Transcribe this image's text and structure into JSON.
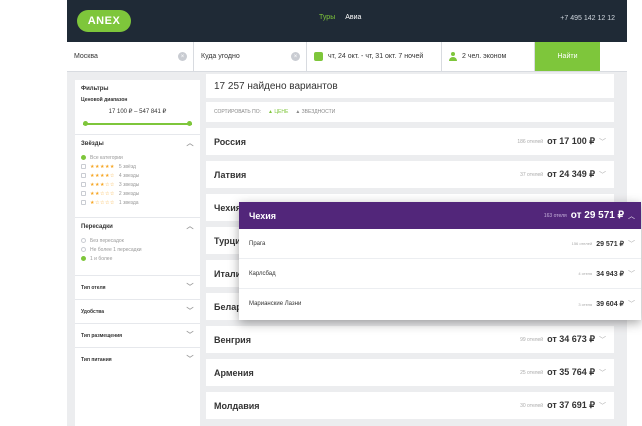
{
  "header": {
    "logo": "ANEX",
    "nav": [
      "Туры",
      "Авиа"
    ],
    "phone": "+7 495 142 12 12"
  },
  "search": {
    "from": "Москва",
    "to_placeholder": "Куда угодно",
    "dates": "чт, 24 окт. - чт, 31 окт. 7 ночей",
    "guests": "2 чел. эконом",
    "submit": "Найти"
  },
  "filters": {
    "title": "Фильтры",
    "price_title": "Ценовой диапазон",
    "price_range": "17 100 ₽ – 547 841 ₽",
    "stars_title": "Звёзды",
    "stars_all": "Все категории",
    "stars_options": [
      {
        "stars": "★★★★★",
        "label": "5 звёзд"
      },
      {
        "stars": "★★★★☆",
        "label": "4 звезды"
      },
      {
        "stars": "★★★☆☆",
        "label": "3 звезды"
      },
      {
        "stars": "★★☆☆☆",
        "label": "2 звезды"
      },
      {
        "stars": "★☆☆☆☆",
        "label": "1 звезда"
      }
    ],
    "transfers_title": "Пересадки",
    "transfers_options": [
      "Без пересадок",
      "Не более 1 пересадки",
      "1 и более"
    ],
    "collapsed": [
      "Тип отеля",
      "Удобства",
      "Тип размещения",
      "Тип питания"
    ]
  },
  "results": {
    "count": "17 257 найдено вариантов",
    "sort_label": "СОРТИРОВАТЬ ПО:",
    "sort_price": "ЦЕНЕ",
    "sort_stars": "ЗВЕЗДНОСТИ",
    "countries": [
      {
        "name": "Россия",
        "hotels": "186 отелей",
        "price": "от 17 100 ₽"
      },
      {
        "name": "Латвия",
        "hotels": "37 отелей",
        "price": "от 24 349 ₽"
      },
      {
        "name": "Чехия",
        "hotels": "",
        "price": ""
      },
      {
        "name": "Турция",
        "hotels": "",
        "price": ""
      },
      {
        "name": "Италия",
        "hotels": "",
        "price": ""
      },
      {
        "name": "Беларусь",
        "hotels": "",
        "price": ""
      },
      {
        "name": "Венгрия",
        "hotels": "99 отелей",
        "price": "от 34 673 ₽"
      },
      {
        "name": "Армения",
        "hotels": "25 отелей",
        "price": "от 35 764 ₽"
      },
      {
        "name": "Молдавия",
        "hotels": "30 отелей",
        "price": "от 37 691 ₽"
      }
    ]
  },
  "popup": {
    "country": "Чехия",
    "hotels": "163 отеля",
    "price": "от 29 571 ₽",
    "cities": [
      {
        "name": "Прага",
        "hotels": "156 отелей",
        "price": "29 571 ₽"
      },
      {
        "name": "Карлсбад",
        "hotels": "4 отеля",
        "price": "34 943 ₽"
      },
      {
        "name": "Марианские Лазни",
        "hotels": "3 отеля",
        "price": "39 604 ₽"
      }
    ]
  },
  "colors": {
    "accent": "#7ec63b",
    "header_bg": "#1f2a36",
    "popup_head": "#52267a"
  }
}
